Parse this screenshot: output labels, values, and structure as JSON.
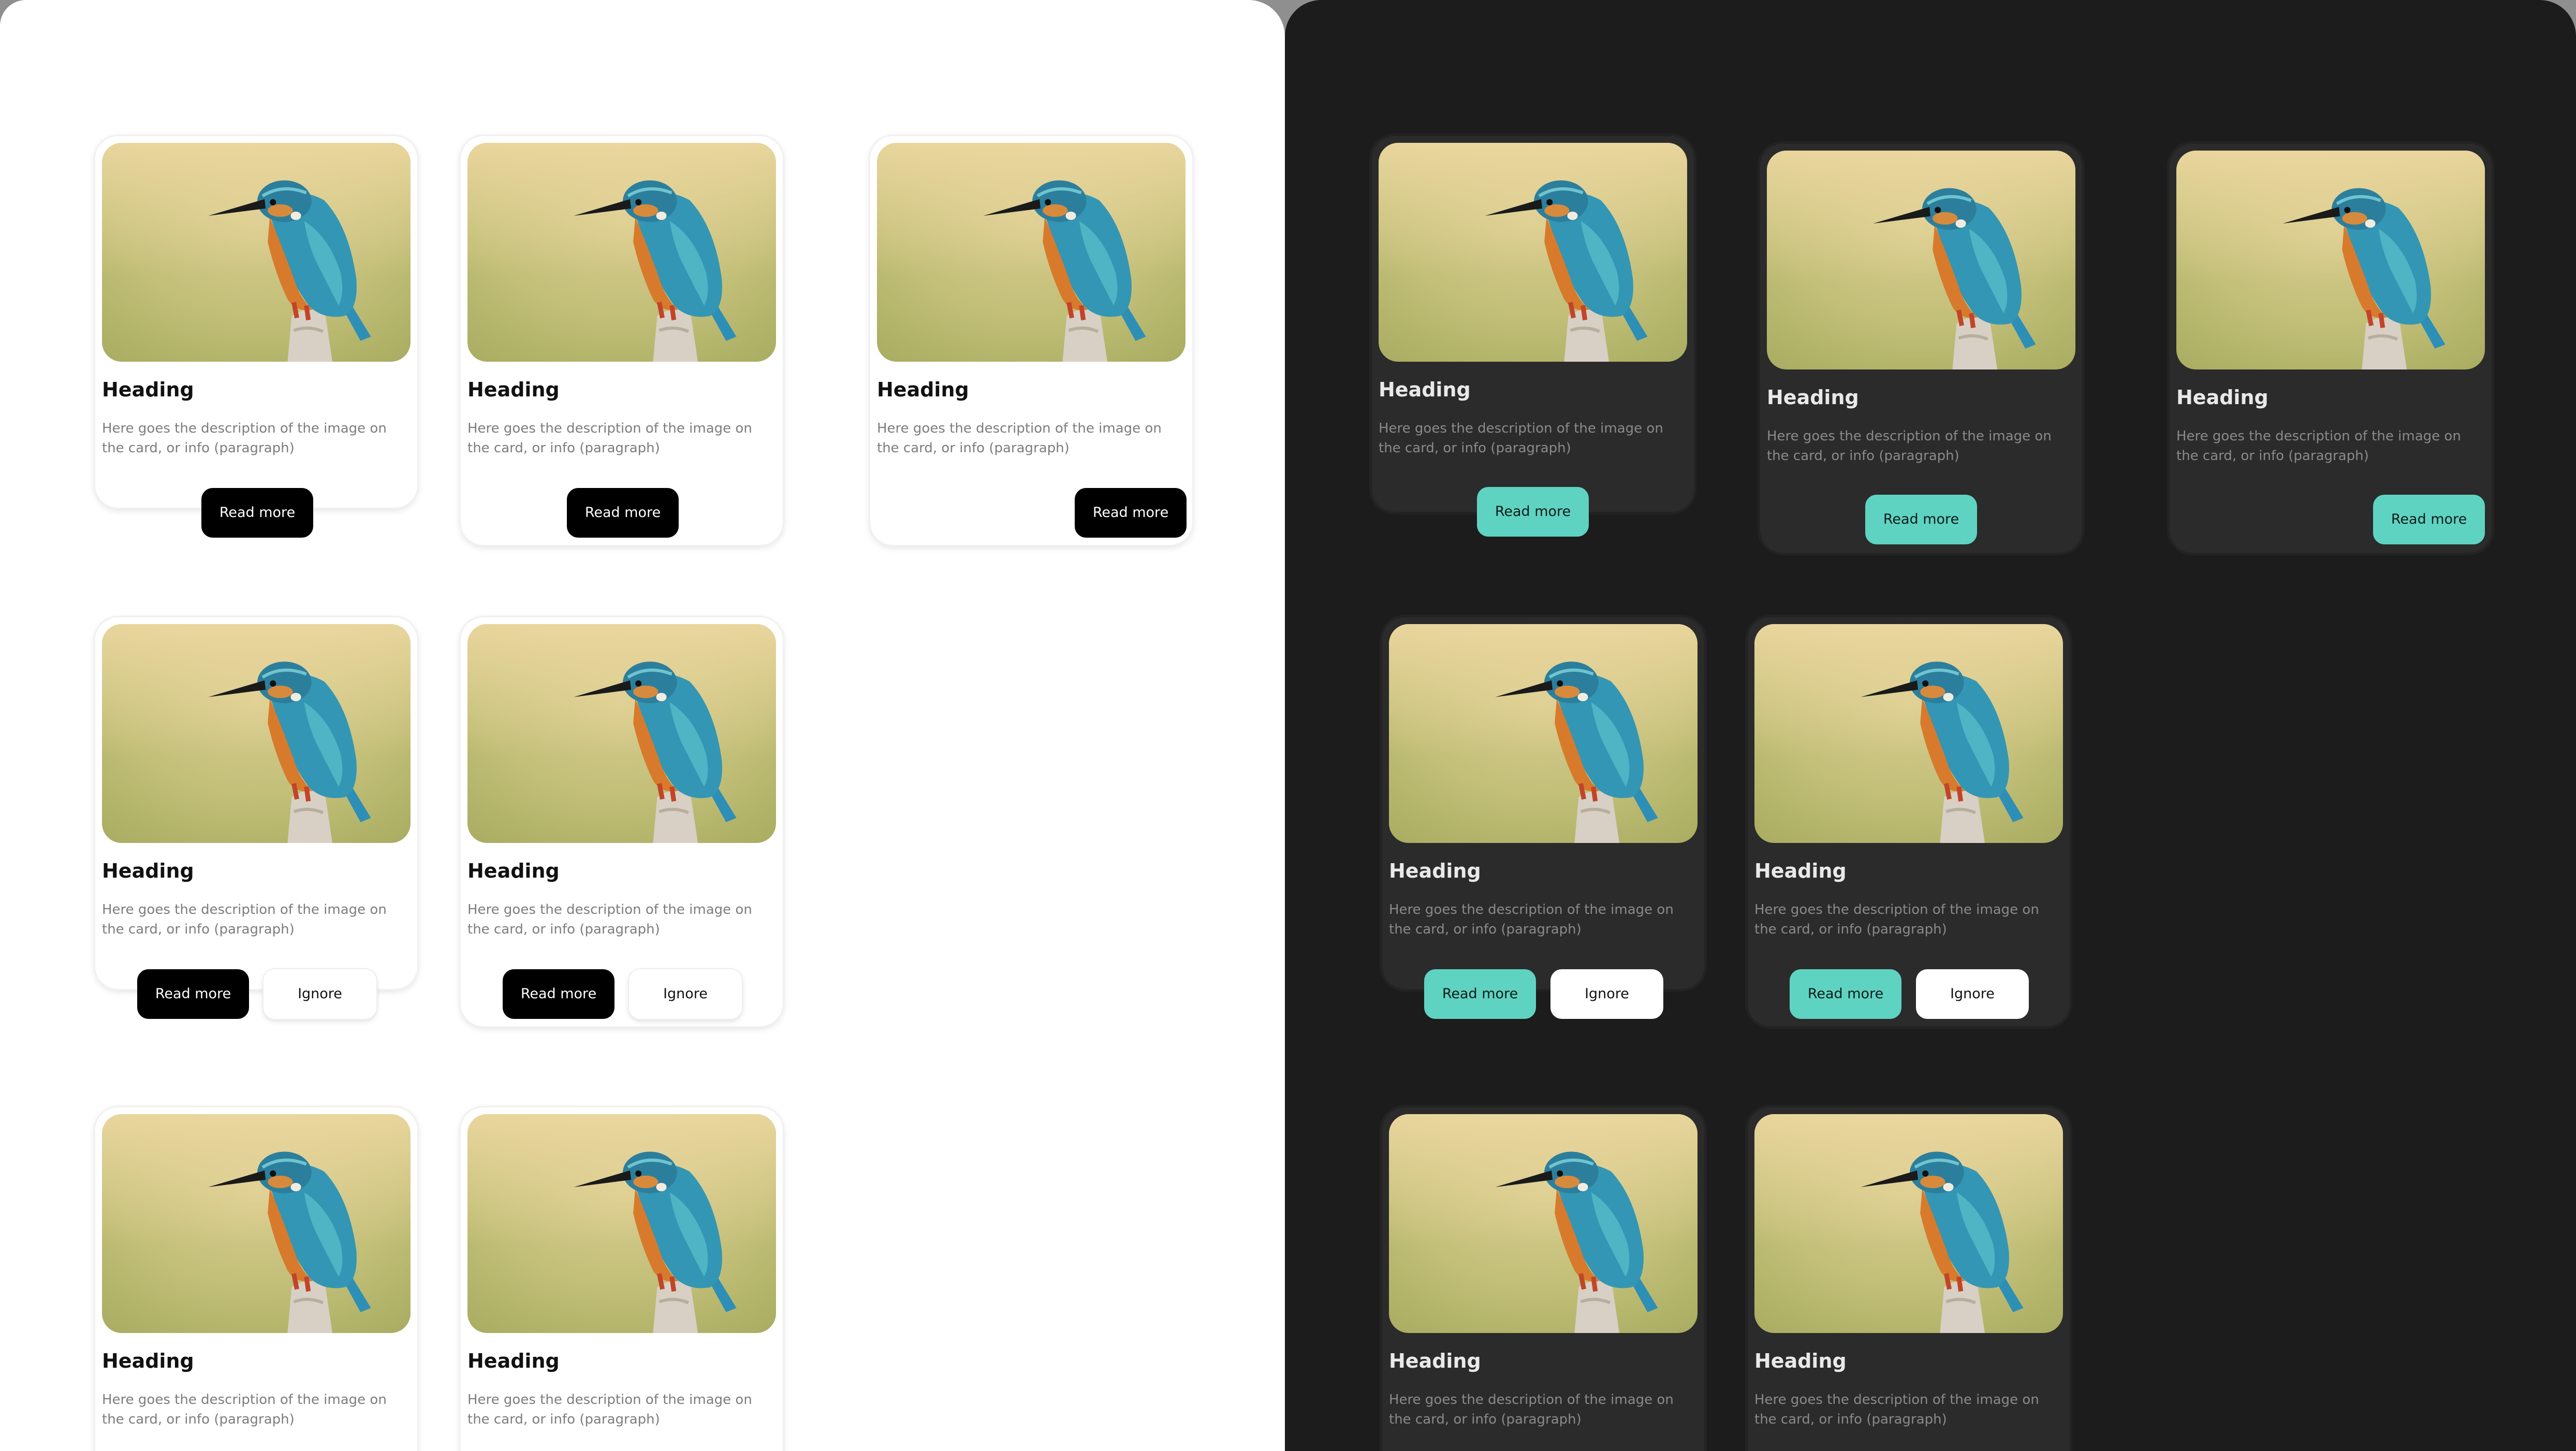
{
  "card": {
    "heading": "Heading",
    "description": "Here goes the description of the image on the card, or info (paragraph)",
    "primary_label": "Read more",
    "secondary_label": "Ignore",
    "image_icon": "kingfisher-photo"
  },
  "colors": {
    "light_background": "#ffffff",
    "dark_background": "#1c1c1c",
    "dark_card": "#2b2b2b",
    "light_primary_button": "#000000",
    "dark_primary_button": "#5fd3c1"
  }
}
